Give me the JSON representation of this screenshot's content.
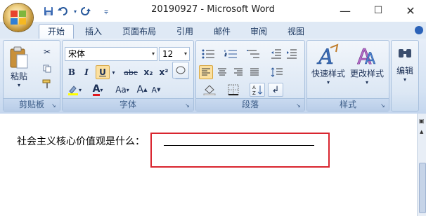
{
  "window": {
    "title": "20190927 - Microsoft Word",
    "controls": {
      "minimize": "—",
      "maximize": "☐",
      "close": "✕"
    }
  },
  "quick_access": {
    "save_icon": "save-icon",
    "undo_icon": "undo-icon",
    "redo_icon": "redo-icon",
    "customize_icon": "customize-icon"
  },
  "tabs": [
    "开始",
    "插入",
    "页面布局",
    "引用",
    "邮件",
    "审阅",
    "视图"
  ],
  "ribbon": {
    "clipboard": {
      "label": "剪贴板",
      "paste": "粘贴"
    },
    "font": {
      "label": "字体",
      "font_name": "宋体",
      "font_size": "12",
      "bold": "B",
      "italic": "I",
      "underline": "U",
      "strike": "abc",
      "subscript": "x₂",
      "superscript": "x²",
      "clear": "Aa",
      "grow": "A",
      "shrink": "A",
      "case": "Aa",
      "font_color": "A"
    },
    "paragraph": {
      "label": "段落"
    },
    "styles": {
      "label": "样式",
      "quick_styles": "快速样式",
      "change_styles": "更改样式"
    },
    "editing": {
      "label": "编辑"
    }
  },
  "document": {
    "question": "社会主义核心价值观是什么："
  },
  "colors": {
    "accent": "#2b579a",
    "highlight_box": "#d9252f",
    "ribbon_bg": "#dce7f4"
  }
}
